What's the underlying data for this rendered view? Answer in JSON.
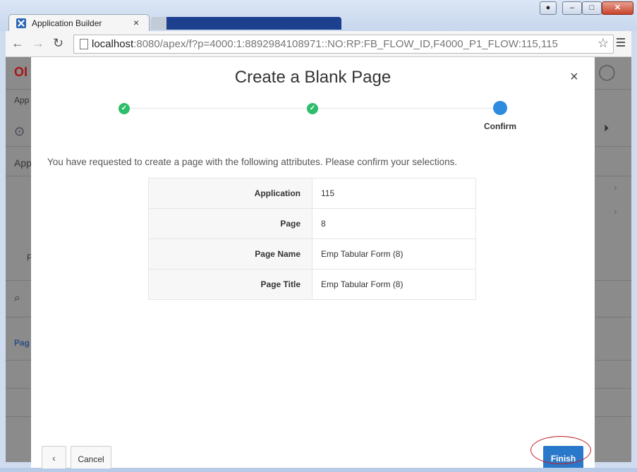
{
  "browser": {
    "active_tab_title": "Application Builder",
    "url_host": "localhost",
    "url_rest": ":8080/apex/f?p=4000:1:8892984108971::NO:RP:FB_FLOW_ID,F4000_P1_FLOW:115,115",
    "icons": [
      "apex-logo-icon",
      "back-arrow-icon",
      "forward-arrow-icon",
      "reload-icon",
      "page-icon",
      "star-icon",
      "chrome-menu-icon",
      "minimize-icon",
      "maximize-icon",
      "close-icon"
    ]
  },
  "background_page": {
    "logo_fragment": "OI",
    "app_crumb": "App",
    "section_label": "App",
    "side_label": "P",
    "list_label": "Pag"
  },
  "modal": {
    "title": "Create a Blank Page",
    "close_symbol": "×",
    "steps": [
      {
        "state": "complete",
        "symbol": "✓",
        "label": ""
      },
      {
        "state": "complete",
        "symbol": "✓",
        "label": ""
      },
      {
        "state": "current",
        "symbol": "",
        "label": "Confirm"
      }
    ],
    "intro_text": "You have requested to create a page with the following attributes. Please confirm your selections.",
    "attributes": [
      {
        "label": "Application",
        "value": "115"
      },
      {
        "label": "Page",
        "value": "8"
      },
      {
        "label": "Page Name",
        "value": "Emp Tabular Form (8)"
      },
      {
        "label": "Page Title",
        "value": "Emp Tabular Form (8)"
      }
    ],
    "buttons": {
      "previous_symbol": "‹",
      "cancel_label": "Cancel",
      "finish_label": "Finish"
    },
    "colors": {
      "step_complete": "#2ebd6b",
      "step_current": "#2e8cdf",
      "finish_button": "#2a78c9",
      "highlight_ring": "#c2202a"
    }
  }
}
